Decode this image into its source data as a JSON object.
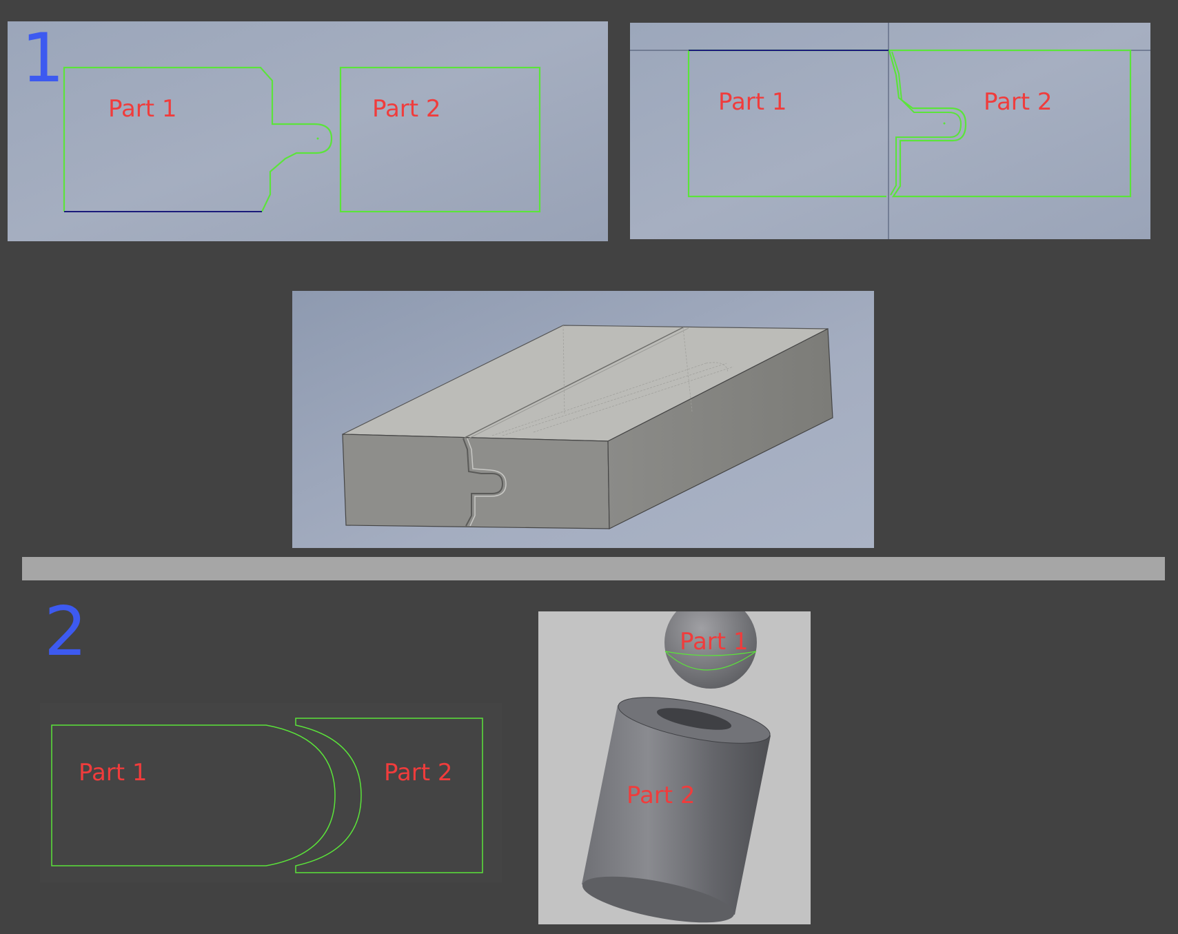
{
  "section_1": {
    "number": "1"
  },
  "section_2": {
    "number": "2"
  },
  "labels": {
    "part1": "Part 1",
    "part2": "Part 2"
  },
  "colors": {
    "background": "#424242",
    "sketch_line": "#5be43a",
    "label_text": "#f03c3c",
    "section_number": "#3d5af0",
    "divider": "#a6a6a6",
    "viewport_gradient_start": "#9aa5b9",
    "viewport_gradient_end": "#a7b0c2"
  },
  "icons": {
    "section_1_sketch": "jigsaw-tab-joint-sketch",
    "section_1_mated": "jigsaw-tab-joint-mated-sketch",
    "section_1_3d": "jigsaw-joint-3d-model",
    "section_2_sketch": "concave-convex-joint-sketch",
    "section_2_3d": "ball-and-socket-3d-model"
  }
}
